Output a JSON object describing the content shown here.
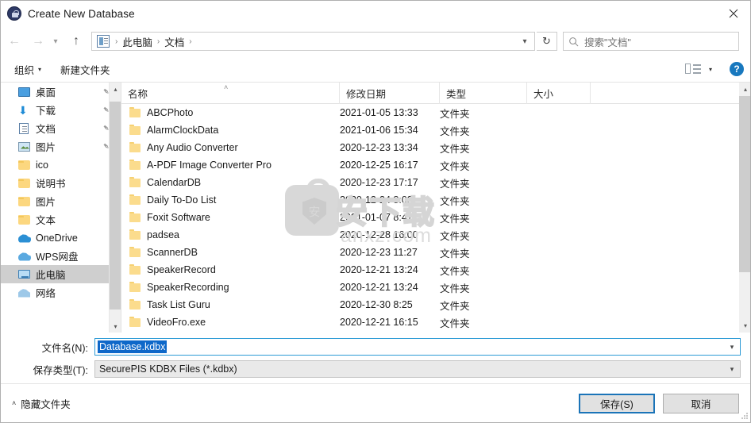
{
  "window": {
    "title": "Create New Database",
    "app_icon": "lock-icon",
    "close_label": "✕"
  },
  "nav": {
    "back_icon": "arrow-left-icon",
    "forward_icon": "arrow-right-icon",
    "recent_icon": "chevron-down-icon",
    "up_icon": "arrow-up-icon",
    "breadcrumb_icon": "documents-icon",
    "breadcrumb": [
      {
        "label": "此电脑"
      },
      {
        "label": "文档"
      }
    ],
    "separator": "›",
    "dropdown_icon": "chevron-down-icon",
    "refresh_icon": "refresh-icon",
    "refresh_glyph": "↻"
  },
  "search": {
    "icon": "search-icon",
    "placeholder": "搜索\"文档\""
  },
  "toolbar": {
    "organize_label": "组织",
    "organize_caret": "▾",
    "new_folder_label": "新建文件夹",
    "view_icon": "view-mode-icon",
    "view_caret": "▾",
    "help_icon": "help-icon",
    "help_label": "?"
  },
  "sidebar": {
    "items": [
      {
        "label": "桌面",
        "icon": "desktop-icon",
        "pinned": true,
        "selected": false
      },
      {
        "label": "下载",
        "icon": "downloads-icon",
        "pinned": true,
        "selected": false
      },
      {
        "label": "文档",
        "icon": "documents-icon",
        "pinned": true,
        "selected": false
      },
      {
        "label": "图片",
        "icon": "pictures-icon",
        "pinned": true,
        "selected": false
      },
      {
        "label": "ico",
        "icon": "folder-icon",
        "pinned": false,
        "selected": false
      },
      {
        "label": "说明书",
        "icon": "folder-icon",
        "pinned": false,
        "selected": false
      },
      {
        "label": "图片",
        "icon": "folder-icon",
        "pinned": false,
        "selected": false
      },
      {
        "label": "文本",
        "icon": "folder-icon",
        "pinned": false,
        "selected": false
      },
      {
        "label": "OneDrive",
        "icon": "onedrive-icon",
        "pinned": false,
        "selected": false
      },
      {
        "label": "WPS网盘",
        "icon": "wps-cloud-icon",
        "pinned": false,
        "selected": false
      },
      {
        "label": "此电脑",
        "icon": "this-pc-icon",
        "pinned": false,
        "selected": true
      },
      {
        "label": "网络",
        "icon": "network-icon",
        "pinned": false,
        "selected": false
      }
    ],
    "pin_icon": "pin-icon",
    "scroll_up_icon": "chevron-up-icon",
    "scroll_down_icon": "chevron-down-icon"
  },
  "filelist": {
    "columns": [
      {
        "label": "名称",
        "key": "name"
      },
      {
        "label": "修改日期",
        "key": "date"
      },
      {
        "label": "类型",
        "key": "type"
      },
      {
        "label": "大小",
        "key": "size"
      }
    ],
    "sort_indicator": "˄",
    "rows": [
      {
        "name": "ABCPhoto",
        "date": "2021-01-05 13:33",
        "type": "文件夹",
        "size": "",
        "icon": "folder-icon"
      },
      {
        "name": "AlarmClockData",
        "date": "2021-01-06 15:34",
        "type": "文件夹",
        "size": "",
        "icon": "folder-icon"
      },
      {
        "name": "Any Audio Converter",
        "date": "2020-12-23 13:34",
        "type": "文件夹",
        "size": "",
        "icon": "folder-icon"
      },
      {
        "name": "A-PDF Image Converter Pro",
        "date": "2020-12-25 16:17",
        "type": "文件夹",
        "size": "",
        "icon": "folder-icon"
      },
      {
        "name": "CalendarDB",
        "date": "2020-12-23 17:17",
        "type": "文件夹",
        "size": "",
        "icon": "folder-icon"
      },
      {
        "name": "Daily To-Do List",
        "date": "2020-12-24 8:02",
        "type": "文件夹",
        "size": "",
        "icon": "folder-icon"
      },
      {
        "name": "Foxit Software",
        "date": "2021-01-07 8:47",
        "type": "文件夹",
        "size": "",
        "icon": "folder-icon"
      },
      {
        "name": "padsea",
        "date": "2020-12-28 16:00",
        "type": "文件夹",
        "size": "",
        "icon": "folder-icon"
      },
      {
        "name": "ScannerDB",
        "date": "2020-12-23 11:27",
        "type": "文件夹",
        "size": "",
        "icon": "folder-icon"
      },
      {
        "name": "SpeakerRecord",
        "date": "2020-12-21 13:24",
        "type": "文件夹",
        "size": "",
        "icon": "folder-icon"
      },
      {
        "name": "SpeakerRecording",
        "date": "2020-12-21 13:24",
        "type": "文件夹",
        "size": "",
        "icon": "folder-icon"
      },
      {
        "name": "Task List Guru",
        "date": "2020-12-30 8:25",
        "type": "文件夹",
        "size": "",
        "icon": "folder-icon"
      },
      {
        "name": "VideoFro.exe",
        "date": "2020-12-21 16:15",
        "type": "文件夹",
        "size": "",
        "icon": "folder-icon"
      }
    ],
    "scroll_up_icon": "chevron-up-icon",
    "scroll_down_icon": "chevron-down-icon"
  },
  "watermark": {
    "brand": "安下载",
    "domain": "anxz.com",
    "badge_char": "安"
  },
  "form": {
    "filename_label": "文件名(N):",
    "filename_value": "Database.kdbx",
    "filetype_label": "保存类型(T):",
    "filetype_value": "SecurePIS KDBX Files (*.kdbx)",
    "caret": "▾"
  },
  "footer": {
    "hide_folders_label": "隐藏文件夹",
    "hide_folders_caret": "˄",
    "save_label": "保存(S)",
    "cancel_label": "取消"
  },
  "colors": {
    "accent": "#1b74b8",
    "selection": "#0e68c9",
    "focus_border": "#2e9bd6",
    "folder": "#fbdc8d",
    "help_blue": "#1878be"
  }
}
